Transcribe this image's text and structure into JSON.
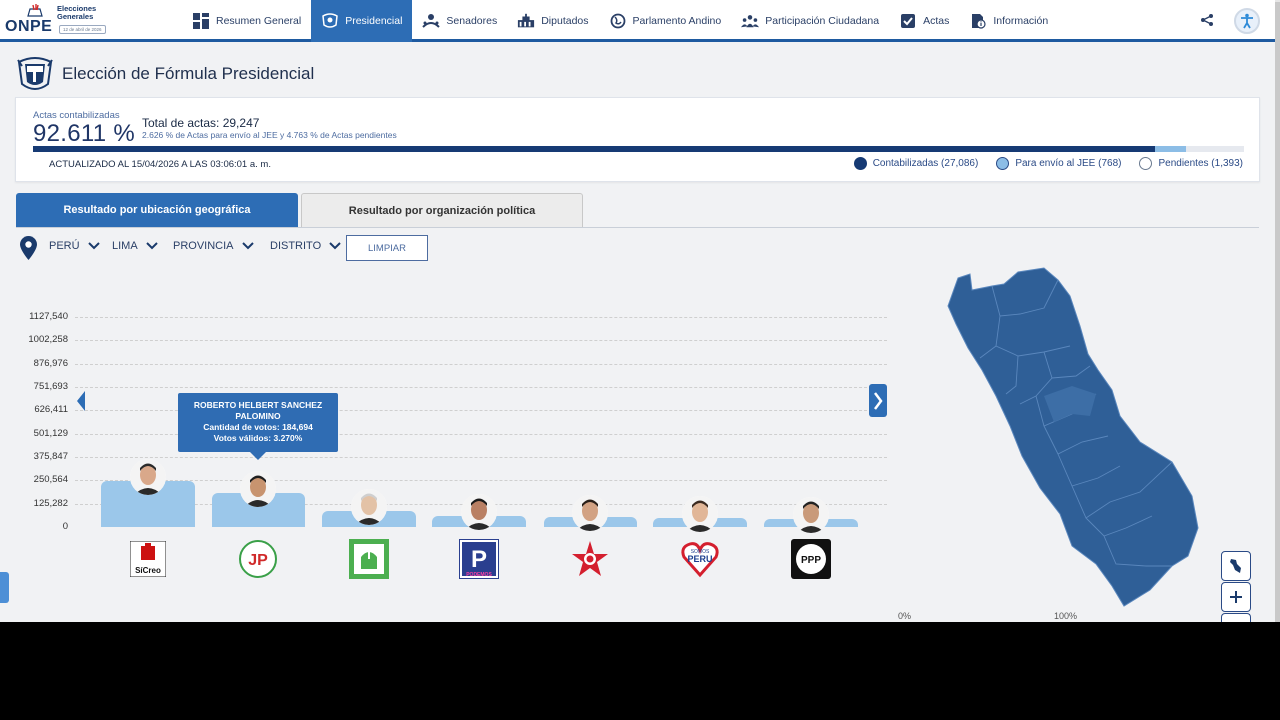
{
  "header": {
    "logo_text": "ONPE",
    "event_title": "Elecciones Generales",
    "event_date": "12 de abril de 2026",
    "nav": [
      {
        "label": "Resumen General",
        "icon": "dashboard-icon",
        "active": false
      },
      {
        "label": "Presidencial",
        "icon": "emblem-icon",
        "active": true
      },
      {
        "label": "Senadores",
        "icon": "senate-icon",
        "active": false
      },
      {
        "label": "Diputados",
        "icon": "congress-icon",
        "active": false
      },
      {
        "label": "Parlamento Andino",
        "icon": "globe-icon",
        "active": false
      },
      {
        "label": "Participación Ciudadana",
        "icon": "people-icon",
        "active": false
      },
      {
        "label": "Actas",
        "icon": "checklist-icon",
        "active": false
      },
      {
        "label": "Información",
        "icon": "info-doc-icon",
        "active": false
      }
    ]
  },
  "page": {
    "title": "Elección de Fórmula Presidencial"
  },
  "summary": {
    "actas_label": "Actas contabilizadas",
    "actas_pct": "92.611 %",
    "total_label": "Total de actas: 29,247",
    "sub_text": "2.626 % de Actas para envío al JEE y 4.763 % de Actas pendientes",
    "progress": {
      "contabilizadas": 92.611,
      "jee": 2.626,
      "pendientes": 4.763
    },
    "updated": "ACTUALIZADO AL 15/04/2026 A LAS 03:06:01 a. m.",
    "legend": [
      {
        "label": "Contabilizadas (27,086)",
        "color": "#163a74"
      },
      {
        "label": "Para envío al JEE (768)",
        "color": "#8cbde6"
      },
      {
        "label": "Pendientes (1,393)",
        "color": "#ffffff"
      }
    ]
  },
  "tabs": {
    "geo": "Resultado por ubicación geográfica",
    "org": "Resultado por organización política"
  },
  "filters": {
    "country": "PERÚ",
    "region": "LIMA",
    "province": "PROVINCIA",
    "district": "DISTRITO",
    "clear": "LIMPIAR"
  },
  "chart_data": {
    "type": "bar",
    "y_ticks": [
      "1127,540",
      "1002,258",
      "876,976",
      "751,693",
      "626,411",
      "501,129",
      "375,847",
      "250,564",
      "125,282",
      "0"
    ],
    "ylim": [
      0,
      1127540
    ],
    "parties": [
      "Sí Creo",
      "Juntos por el Perú",
      "Partido (logo verde)",
      "Podemos",
      "Perú Libre",
      "Somos Perú",
      "PPP"
    ],
    "values": [
      245000,
      184694,
      85000,
      60000,
      52000,
      50000,
      45000
    ],
    "logo_text": [
      "SíCreo",
      "JP",
      "",
      "PODEMOS",
      "",
      "SOMOS PERU",
      "PPP"
    ]
  },
  "tooltip": {
    "name": "ROBERTO HELBERT SANCHEZ PALOMINO",
    "votes": "Cantidad de votos: 184,694",
    "valid": "Votos válidos: 3.270%"
  },
  "map": {
    "scale_min": "0%",
    "scale_max": "100%",
    "fill": "#2f5f97"
  }
}
